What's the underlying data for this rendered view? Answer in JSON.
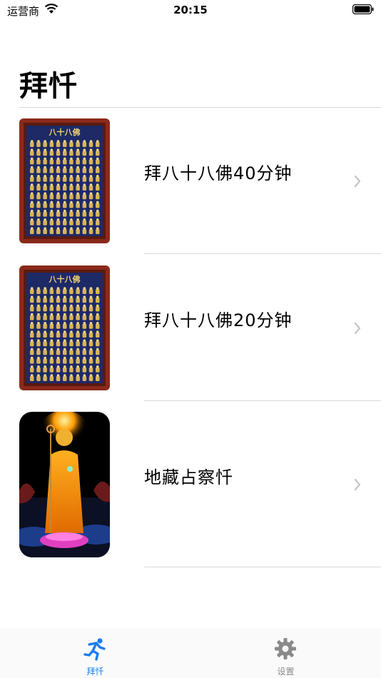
{
  "status_bar": {
    "carrier": "运营商",
    "time": "20:15"
  },
  "page": {
    "title": "拜忏"
  },
  "items": [
    {
      "label": "拜八十八佛40分钟",
      "thumb_caption": "八十八佛"
    },
    {
      "label": "拜八十八佛20分钟",
      "thumb_caption": "八十八佛"
    },
    {
      "label": "地藏占察忏"
    }
  ],
  "tab_bar": {
    "tabs": [
      {
        "label": "拜忏",
        "icon": "runner-icon",
        "active": true
      },
      {
        "label": "设置",
        "icon": "gear-icon",
        "active": false
      }
    ]
  },
  "colors": {
    "accent": "#1a7cf0",
    "inactive": "#8a8a8a",
    "divider": "#d7d7d7",
    "thumb_navy": "#1e2a66",
    "thumb_gold": "#d8b458",
    "thumb_frame": "#8a2a1a"
  }
}
